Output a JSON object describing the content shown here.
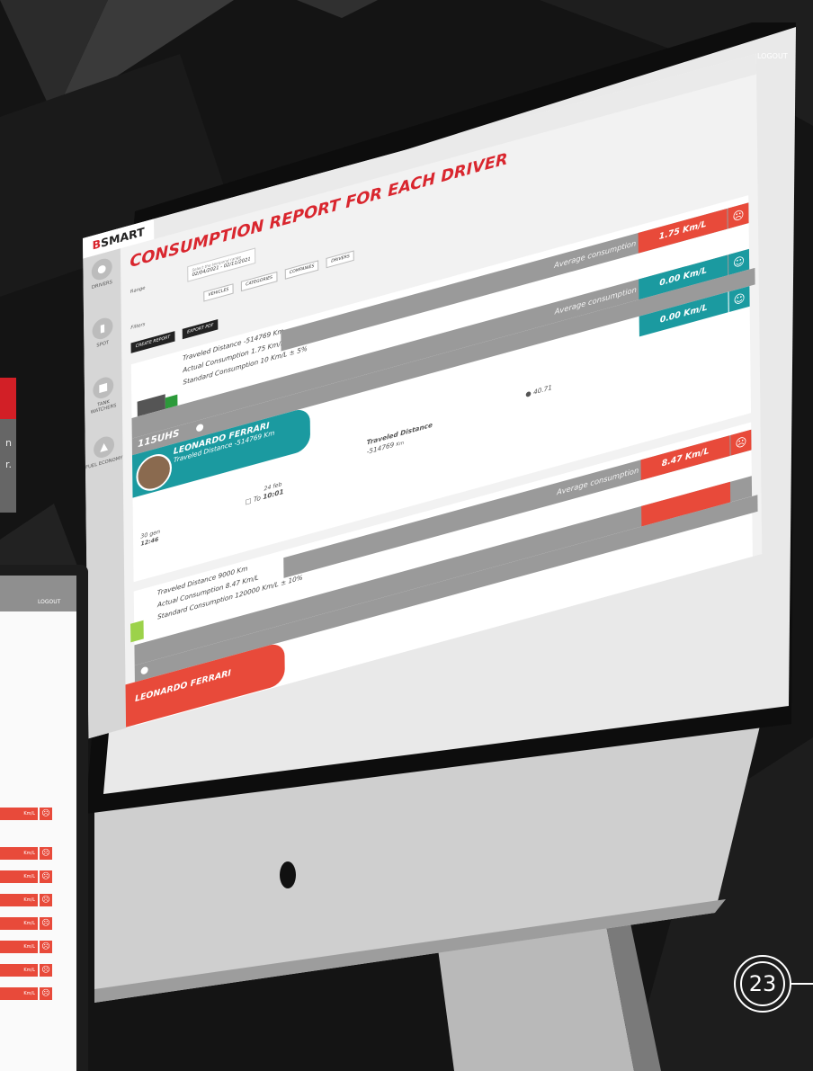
{
  "app": {
    "logo": {
      "prefix": "B",
      "name": "SMART"
    },
    "logout": "LOGOUT",
    "title": "CONSUMPTION REPORT FOR EACH DRIVER"
  },
  "sidebar": {
    "items": [
      {
        "label": "DRIVERS",
        "icon": "person-icon"
      },
      {
        "label": "SPOT",
        "icon": "fuel-pump-icon"
      },
      {
        "label": "TANK WATCHERS",
        "icon": "tank-icon"
      },
      {
        "label": "FUEL ECONOMY",
        "icon": "truck-icon"
      }
    ]
  },
  "filters": {
    "range_label": "Range",
    "range_hint": "Select the temporal range",
    "range_value": "02/04/2021 - 02/11/2021",
    "filters_label": "Filters",
    "chips": [
      "VEHICLES",
      "CATEGORIES",
      "COMPANIES",
      "DRIVERS"
    ],
    "create_report": "CREATE REPORT",
    "export_pdf": "EXPORT PDF"
  },
  "report": {
    "card1": {
      "traveled": "Traveled Distance -514769 Km",
      "actual": "Actual Consumption 1.75 Km/L",
      "standard": "Standard Consumption 10 Km/L ± 5%",
      "avg_label_1": "Average consumption",
      "avg_value_1": "1.75 Km/L",
      "avg_label_2": "Average consumption",
      "avg_value_2": "0.00 Km/L",
      "plate": "115UHS",
      "driver_name": "LEONARDO FERRARI",
      "driver_traveled": "Traveled Distance -514769 Km",
      "driver_value": "0.00 Km/L",
      "col_traveled_label": "Traveled Distance",
      "col_traveled_value": "-514769",
      "col_traveled_unit": "Km",
      "fuel_value": "40.71",
      "from_date": "30 gen",
      "from_time": "12:46",
      "to_label": "To",
      "to_date": "24 feb",
      "to_time": "10:01"
    },
    "card2": {
      "traveled": "Traveled Distance 9000 Km",
      "actual": "Actual Consumption 8.47 Km/L",
      "standard": "Standard Consumption 120000 Km/L ± 10%",
      "avg_label": "Average consumption",
      "avg_value": "8.47 Km/L",
      "driver_name": "LEONARDO FERRARI"
    }
  },
  "tablet": {
    "logout": "LOGOUT",
    "rows": [
      "Km/L",
      "Km/L",
      "Km/L",
      "Km/L",
      "Km/L",
      "Km/L",
      "Km/L",
      "Km/L"
    ]
  },
  "page_number": "23",
  "colors": {
    "brand_red": "#d9262e",
    "bad": "#e84a3a",
    "good": "#1b9aa0",
    "band": "#9a9a9a"
  }
}
